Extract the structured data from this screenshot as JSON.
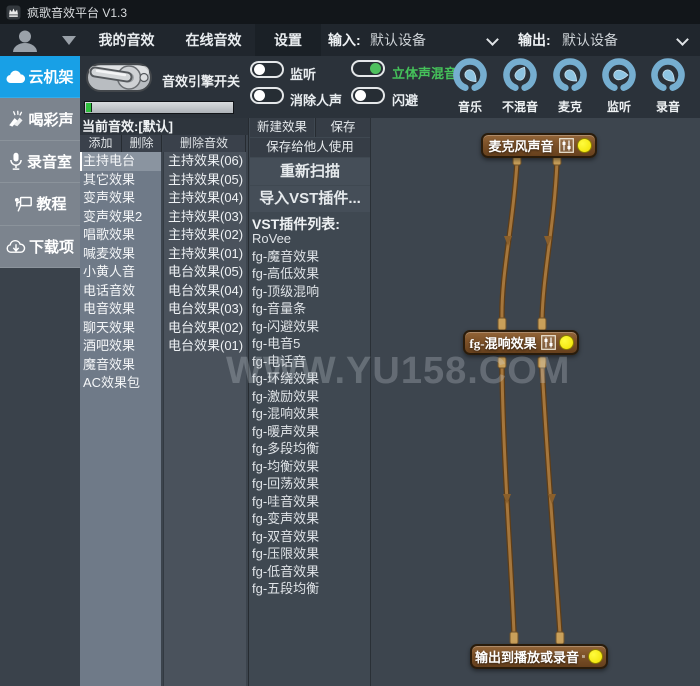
{
  "window": {
    "title": "疯歌音效平台 V1.3"
  },
  "topbar": {
    "tabs": [
      "我的音效",
      "在线音效",
      "设置"
    ],
    "input_label": "输入:",
    "input_value": "默认设备",
    "output_label": "输出:",
    "output_value": "默认设备"
  },
  "sidebar": {
    "items": [
      {
        "label": "云机架",
        "icon": "cloud-icon",
        "selected": true
      },
      {
        "label": "喝彩声",
        "icon": "clap-icon",
        "selected": false
      },
      {
        "label": "录音室",
        "icon": "mic-icon",
        "selected": false
      },
      {
        "label": "教程",
        "icon": "tutorial-icon",
        "selected": false
      },
      {
        "label": "下载项",
        "icon": "download-icon",
        "selected": false
      }
    ]
  },
  "engine": {
    "switch_label": "音效引擎开关"
  },
  "toggles": [
    {
      "label": "监听",
      "on": false
    },
    {
      "label": "消除人声",
      "on": false
    },
    {
      "label": "立体声混音",
      "on": true
    },
    {
      "label": "闪避",
      "on": false
    }
  ],
  "knobs": [
    {
      "label": "音乐"
    },
    {
      "label": "不混音"
    },
    {
      "label": "麦克"
    },
    {
      "label": "监听"
    },
    {
      "label": "录音"
    }
  ],
  "effects_panel": {
    "current_label": "当前音效:[默认]",
    "add": "添加",
    "delete": "删除",
    "delete_effect": "删除音效",
    "selected_category": "主持电台",
    "categories": [
      "主持电台",
      "其它效果",
      "变声效果",
      "变声效果2",
      "唱歌效果",
      "喊麦效果",
      "小黄人音",
      "电话音效",
      "电音效果",
      "聊天效果",
      "酒吧效果",
      "魔音效果",
      "AC效果包"
    ],
    "presets": [
      "主持效果(06)",
      "主持效果(05)",
      "主持效果(04)",
      "主持效果(03)",
      "主持效果(02)",
      "主持效果(01)",
      "电台效果(05)",
      "电台效果(04)",
      "电台效果(03)",
      "电台效果(02)",
      "电台效果(01)"
    ]
  },
  "vst_panel": {
    "new_effect": "新建效果",
    "save": "保存",
    "save_for_others": "保存给他人使用",
    "rescan": "重新扫描",
    "import_vst": "导入VST插件...",
    "list_label": "VST插件列表:",
    "plugins": [
      "RoVee",
      "fg-魔音效果",
      "fg-高低效果",
      "fg-顶级混响",
      "fg-音量条",
      "fg-闪避效果",
      "fg-电音5",
      "fg-电话音",
      "fg-环绕效果",
      "fg-激励效果",
      "fg-混响效果",
      "fg-暖声效果",
      "fg-多段均衡",
      "fg-均衡效果",
      "fg-回荡效果",
      "fg-哇音效果",
      "fg-变声效果",
      "fg-双音效果",
      "fg-压限效果",
      "fg-低音效果",
      "fg-五段均衡"
    ]
  },
  "graph": {
    "nodes": [
      {
        "label": "麦克风声音"
      },
      {
        "label": "fg-混响效果"
      },
      {
        "label": "输出到播放或录音"
      }
    ]
  },
  "watermark": "WWW.YU158.COM",
  "colors": {
    "accent_blue": "#18a0e6",
    "toggle_green": "#4ec05e",
    "node_brown": "#7c5128",
    "cable": "#a5763c",
    "indicator_yellow": "#efe000",
    "knob_blue": "#76aed0"
  }
}
